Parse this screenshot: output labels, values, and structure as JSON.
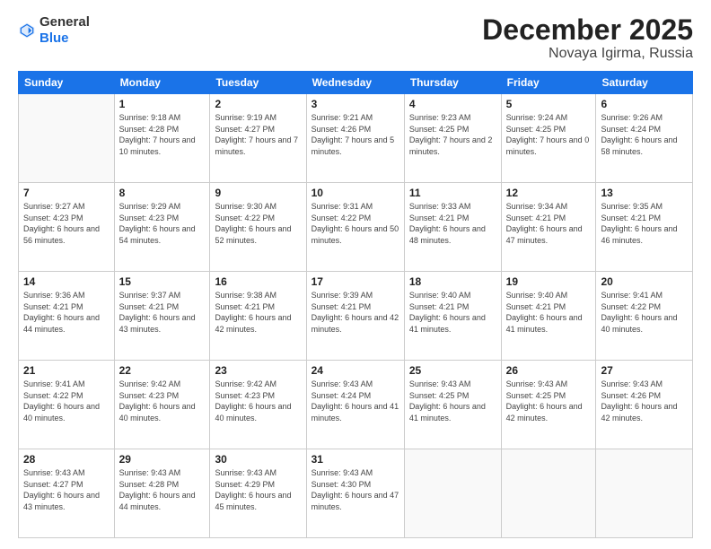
{
  "header": {
    "logo_general": "General",
    "logo_blue": "Blue",
    "month_title": "December 2025",
    "location": "Novaya Igirma, Russia"
  },
  "days_of_week": [
    "Sunday",
    "Monday",
    "Tuesday",
    "Wednesday",
    "Thursday",
    "Friday",
    "Saturday"
  ],
  "weeks": [
    [
      {
        "day": "",
        "sunrise": "",
        "sunset": "",
        "daylight": ""
      },
      {
        "day": "1",
        "sunrise": "Sunrise: 9:18 AM",
        "sunset": "Sunset: 4:28 PM",
        "daylight": "Daylight: 7 hours and 10 minutes."
      },
      {
        "day": "2",
        "sunrise": "Sunrise: 9:19 AM",
        "sunset": "Sunset: 4:27 PM",
        "daylight": "Daylight: 7 hours and 7 minutes."
      },
      {
        "day": "3",
        "sunrise": "Sunrise: 9:21 AM",
        "sunset": "Sunset: 4:26 PM",
        "daylight": "Daylight: 7 hours and 5 minutes."
      },
      {
        "day": "4",
        "sunrise": "Sunrise: 9:23 AM",
        "sunset": "Sunset: 4:25 PM",
        "daylight": "Daylight: 7 hours and 2 minutes."
      },
      {
        "day": "5",
        "sunrise": "Sunrise: 9:24 AM",
        "sunset": "Sunset: 4:25 PM",
        "daylight": "Daylight: 7 hours and 0 minutes."
      },
      {
        "day": "6",
        "sunrise": "Sunrise: 9:26 AM",
        "sunset": "Sunset: 4:24 PM",
        "daylight": "Daylight: 6 hours and 58 minutes."
      }
    ],
    [
      {
        "day": "7",
        "sunrise": "Sunrise: 9:27 AM",
        "sunset": "Sunset: 4:23 PM",
        "daylight": "Daylight: 6 hours and 56 minutes."
      },
      {
        "day": "8",
        "sunrise": "Sunrise: 9:29 AM",
        "sunset": "Sunset: 4:23 PM",
        "daylight": "Daylight: 6 hours and 54 minutes."
      },
      {
        "day": "9",
        "sunrise": "Sunrise: 9:30 AM",
        "sunset": "Sunset: 4:22 PM",
        "daylight": "Daylight: 6 hours and 52 minutes."
      },
      {
        "day": "10",
        "sunrise": "Sunrise: 9:31 AM",
        "sunset": "Sunset: 4:22 PM",
        "daylight": "Daylight: 6 hours and 50 minutes."
      },
      {
        "day": "11",
        "sunrise": "Sunrise: 9:33 AM",
        "sunset": "Sunset: 4:21 PM",
        "daylight": "Daylight: 6 hours and 48 minutes."
      },
      {
        "day": "12",
        "sunrise": "Sunrise: 9:34 AM",
        "sunset": "Sunset: 4:21 PM",
        "daylight": "Daylight: 6 hours and 47 minutes."
      },
      {
        "day": "13",
        "sunrise": "Sunrise: 9:35 AM",
        "sunset": "Sunset: 4:21 PM",
        "daylight": "Daylight: 6 hours and 46 minutes."
      }
    ],
    [
      {
        "day": "14",
        "sunrise": "Sunrise: 9:36 AM",
        "sunset": "Sunset: 4:21 PM",
        "daylight": "Daylight: 6 hours and 44 minutes."
      },
      {
        "day": "15",
        "sunrise": "Sunrise: 9:37 AM",
        "sunset": "Sunset: 4:21 PM",
        "daylight": "Daylight: 6 hours and 43 minutes."
      },
      {
        "day": "16",
        "sunrise": "Sunrise: 9:38 AM",
        "sunset": "Sunset: 4:21 PM",
        "daylight": "Daylight: 6 hours and 42 minutes."
      },
      {
        "day": "17",
        "sunrise": "Sunrise: 9:39 AM",
        "sunset": "Sunset: 4:21 PM",
        "daylight": "Daylight: 6 hours and 42 minutes."
      },
      {
        "day": "18",
        "sunrise": "Sunrise: 9:40 AM",
        "sunset": "Sunset: 4:21 PM",
        "daylight": "Daylight: 6 hours and 41 minutes."
      },
      {
        "day": "19",
        "sunrise": "Sunrise: 9:40 AM",
        "sunset": "Sunset: 4:21 PM",
        "daylight": "Daylight: 6 hours and 41 minutes."
      },
      {
        "day": "20",
        "sunrise": "Sunrise: 9:41 AM",
        "sunset": "Sunset: 4:22 PM",
        "daylight": "Daylight: 6 hours and 40 minutes."
      }
    ],
    [
      {
        "day": "21",
        "sunrise": "Sunrise: 9:41 AM",
        "sunset": "Sunset: 4:22 PM",
        "daylight": "Daylight: 6 hours and 40 minutes."
      },
      {
        "day": "22",
        "sunrise": "Sunrise: 9:42 AM",
        "sunset": "Sunset: 4:23 PM",
        "daylight": "Daylight: 6 hours and 40 minutes."
      },
      {
        "day": "23",
        "sunrise": "Sunrise: 9:42 AM",
        "sunset": "Sunset: 4:23 PM",
        "daylight": "Daylight: 6 hours and 40 minutes."
      },
      {
        "day": "24",
        "sunrise": "Sunrise: 9:43 AM",
        "sunset": "Sunset: 4:24 PM",
        "daylight": "Daylight: 6 hours and 41 minutes."
      },
      {
        "day": "25",
        "sunrise": "Sunrise: 9:43 AM",
        "sunset": "Sunset: 4:25 PM",
        "daylight": "Daylight: 6 hours and 41 minutes."
      },
      {
        "day": "26",
        "sunrise": "Sunrise: 9:43 AM",
        "sunset": "Sunset: 4:25 PM",
        "daylight": "Daylight: 6 hours and 42 minutes."
      },
      {
        "day": "27",
        "sunrise": "Sunrise: 9:43 AM",
        "sunset": "Sunset: 4:26 PM",
        "daylight": "Daylight: 6 hours and 42 minutes."
      }
    ],
    [
      {
        "day": "28",
        "sunrise": "Sunrise: 9:43 AM",
        "sunset": "Sunset: 4:27 PM",
        "daylight": "Daylight: 6 hours and 43 minutes."
      },
      {
        "day": "29",
        "sunrise": "Sunrise: 9:43 AM",
        "sunset": "Sunset: 4:28 PM",
        "daylight": "Daylight: 6 hours and 44 minutes."
      },
      {
        "day": "30",
        "sunrise": "Sunrise: 9:43 AM",
        "sunset": "Sunset: 4:29 PM",
        "daylight": "Daylight: 6 hours and 45 minutes."
      },
      {
        "day": "31",
        "sunrise": "Sunrise: 9:43 AM",
        "sunset": "Sunset: 4:30 PM",
        "daylight": "Daylight: 6 hours and 47 minutes."
      },
      {
        "day": "",
        "sunrise": "",
        "sunset": "",
        "daylight": ""
      },
      {
        "day": "",
        "sunrise": "",
        "sunset": "",
        "daylight": ""
      },
      {
        "day": "",
        "sunrise": "",
        "sunset": "",
        "daylight": ""
      }
    ]
  ]
}
